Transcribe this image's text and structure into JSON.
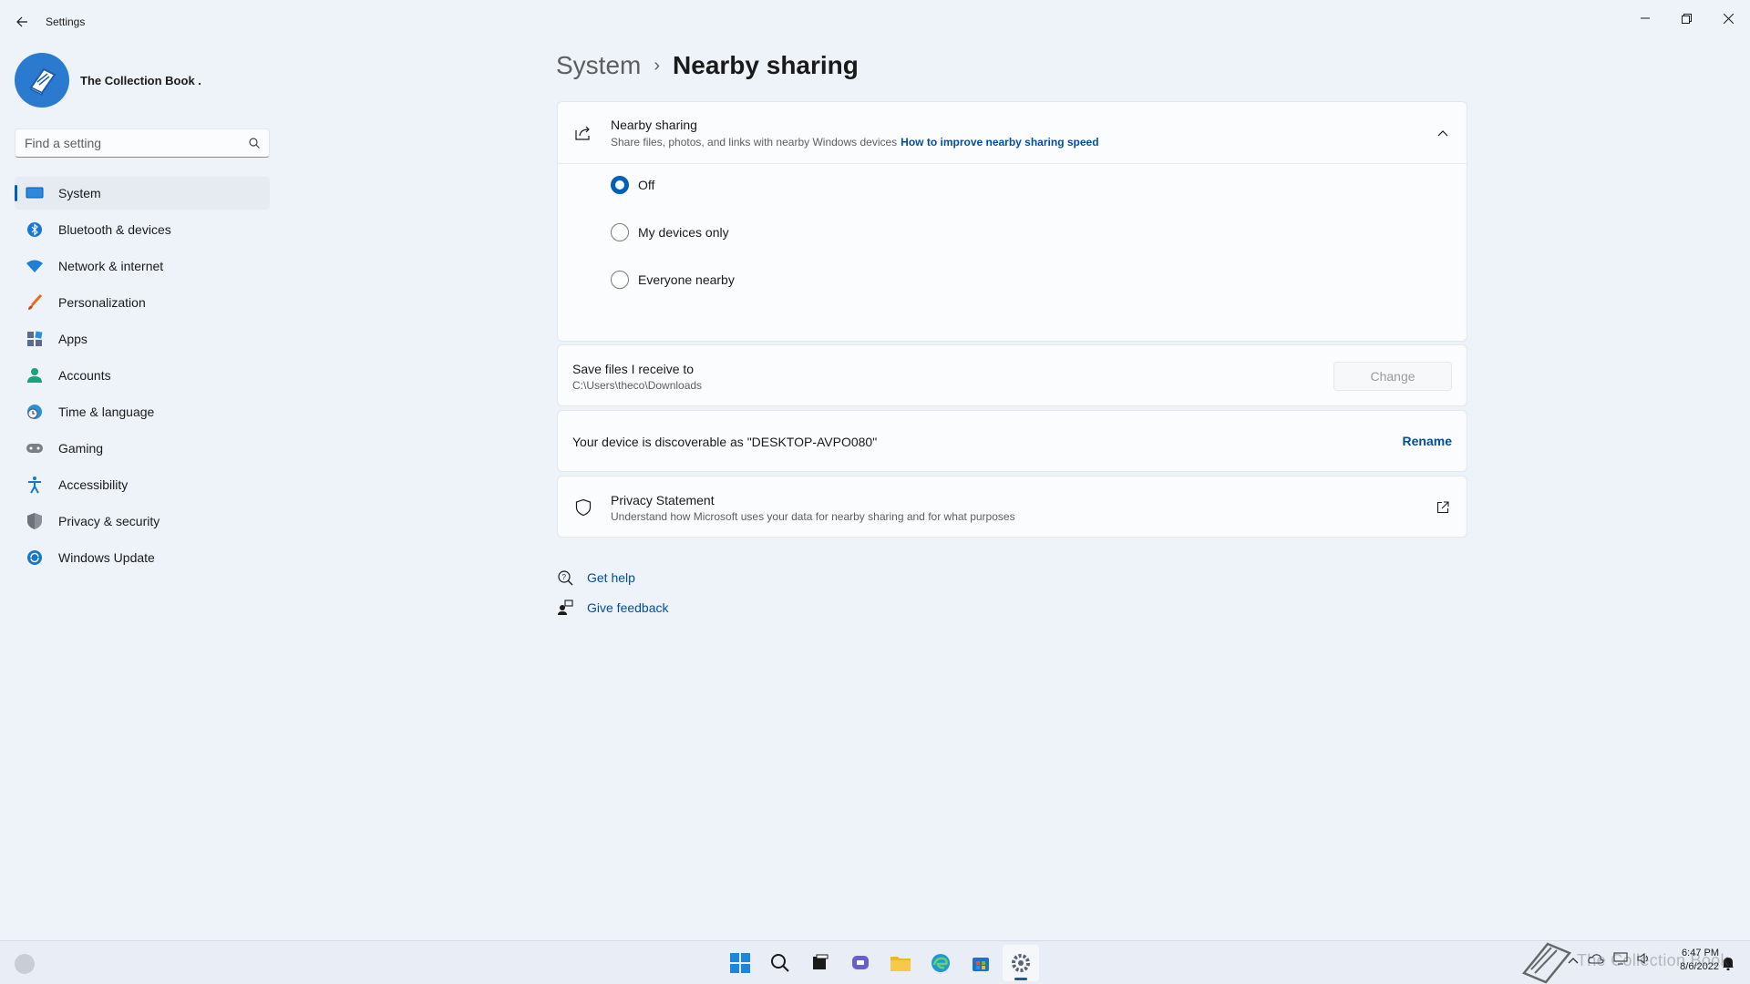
{
  "window": {
    "title": "Settings",
    "controls": {
      "minimize": "minimize",
      "maximize": "restore",
      "close": "close"
    }
  },
  "profile": {
    "name": "The Collection Book ."
  },
  "search": {
    "placeholder": "Find a setting"
  },
  "sidebar": {
    "items": [
      {
        "label": "System",
        "icon": "monitor-icon",
        "color": "#0078d4",
        "active": true
      },
      {
        "label": "Bluetooth & devices",
        "icon": "bluetooth-icon",
        "color": "#0078d4"
      },
      {
        "label": "Network & internet",
        "icon": "wifi-icon",
        "color": "#0078d4"
      },
      {
        "label": "Personalization",
        "icon": "brush-icon",
        "color": "#e86a24"
      },
      {
        "label": "Apps",
        "icon": "apps-icon",
        "color": "#5a6b8c"
      },
      {
        "label": "Accounts",
        "icon": "person-icon",
        "color": "#1aa37a"
      },
      {
        "label": "Time & language",
        "icon": "globe-clock-icon",
        "color": "#2a8fd6"
      },
      {
        "label": "Gaming",
        "icon": "gamepad-icon",
        "color": "#7a7f87"
      },
      {
        "label": "Accessibility",
        "icon": "accessibility-icon",
        "color": "#1677c8"
      },
      {
        "label": "Privacy & security",
        "icon": "shield-icon",
        "color": "#7a7f87"
      },
      {
        "label": "Windows Update",
        "icon": "update-icon",
        "color": "#1677c8"
      }
    ]
  },
  "breadcrumb": {
    "parent": "System",
    "separator": "›",
    "current": "Nearby sharing"
  },
  "nearby": {
    "title": "Nearby sharing",
    "description": "Share files, photos, and links with nearby Windows devices",
    "link": "How to improve nearby sharing speed",
    "expanded": true,
    "options": [
      {
        "label": "Off",
        "checked": true
      },
      {
        "label": "My devices only",
        "checked": false
      },
      {
        "label": "Everyone nearby",
        "checked": false
      }
    ]
  },
  "save_files": {
    "title": "Save files I receive to",
    "path": "C:\\Users\\theco\\Downloads",
    "button": "Change",
    "button_disabled": true
  },
  "discoverable": {
    "text": "Your device is discoverable as \"DESKTOP-AVPO080\"",
    "action": "Rename"
  },
  "privacy": {
    "title": "Privacy Statement",
    "description": "Understand how Microsoft uses your data for nearby sharing and for what purposes"
  },
  "help": {
    "get_help": "Get help",
    "give_feedback": "Give feedback"
  },
  "taskbar": {
    "apps": [
      "windows-start-icon",
      "search-icon",
      "task-view-icon",
      "chat-icon",
      "file-explorer-icon",
      "edge-icon",
      "store-icon",
      "settings-icon"
    ],
    "active_app": "settings-icon",
    "time": "6:47 PM",
    "date": "8/6/2022"
  },
  "watermark": {
    "text": "The Collection Book"
  },
  "colors": {
    "accent": "#005fb8",
    "link": "#004f9e",
    "background": "#eef2f9"
  }
}
